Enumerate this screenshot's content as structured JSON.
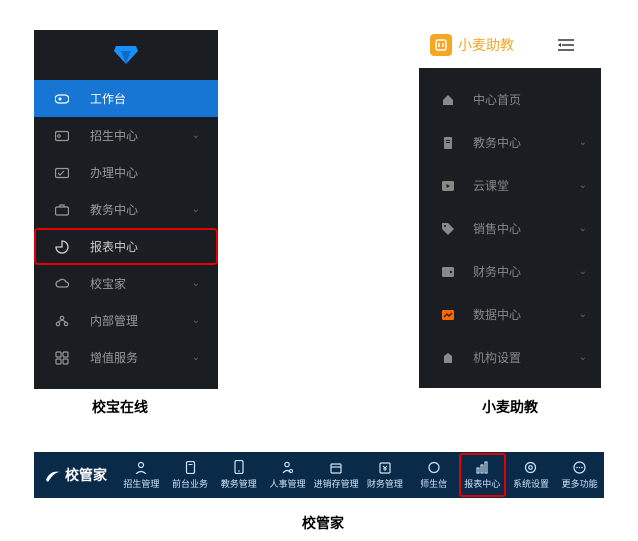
{
  "panels": {
    "xiaobao": {
      "caption": "校宝在线",
      "items": [
        {
          "label": "工作台",
          "active": true
        },
        {
          "label": "招生中心",
          "expandable": true
        },
        {
          "label": "办理中心"
        },
        {
          "label": "教务中心",
          "expandable": true
        },
        {
          "label": "报表中心",
          "highlighted": true
        },
        {
          "label": "校宝家",
          "expandable": true
        },
        {
          "label": "内部管理",
          "expandable": true
        },
        {
          "label": "增值服务",
          "expandable": true
        }
      ]
    },
    "xiaomai": {
      "brand": "小麦助教",
      "caption": "小麦助教",
      "items": [
        {
          "label": "中心首页"
        },
        {
          "label": "教务中心",
          "expandable": true
        },
        {
          "label": "云课堂",
          "expandable": true
        },
        {
          "label": "销售中心",
          "expandable": true
        },
        {
          "label": "财务中心",
          "expandable": true
        },
        {
          "label": "数据中心",
          "expandable": true,
          "highlighted": true
        },
        {
          "label": "机构设置",
          "expandable": true
        }
      ]
    },
    "xiaoguanjia": {
      "brand": "校管家",
      "caption": "校管家",
      "items": [
        {
          "label": "招生管理"
        },
        {
          "label": "前台业务"
        },
        {
          "label": "教务管理"
        },
        {
          "label": "人事管理"
        },
        {
          "label": "进销存管理"
        },
        {
          "label": "财务管理"
        },
        {
          "label": "师生信"
        },
        {
          "label": "报表中心",
          "highlighted": true
        },
        {
          "label": "系统设置"
        },
        {
          "label": "更多功能"
        }
      ]
    }
  }
}
